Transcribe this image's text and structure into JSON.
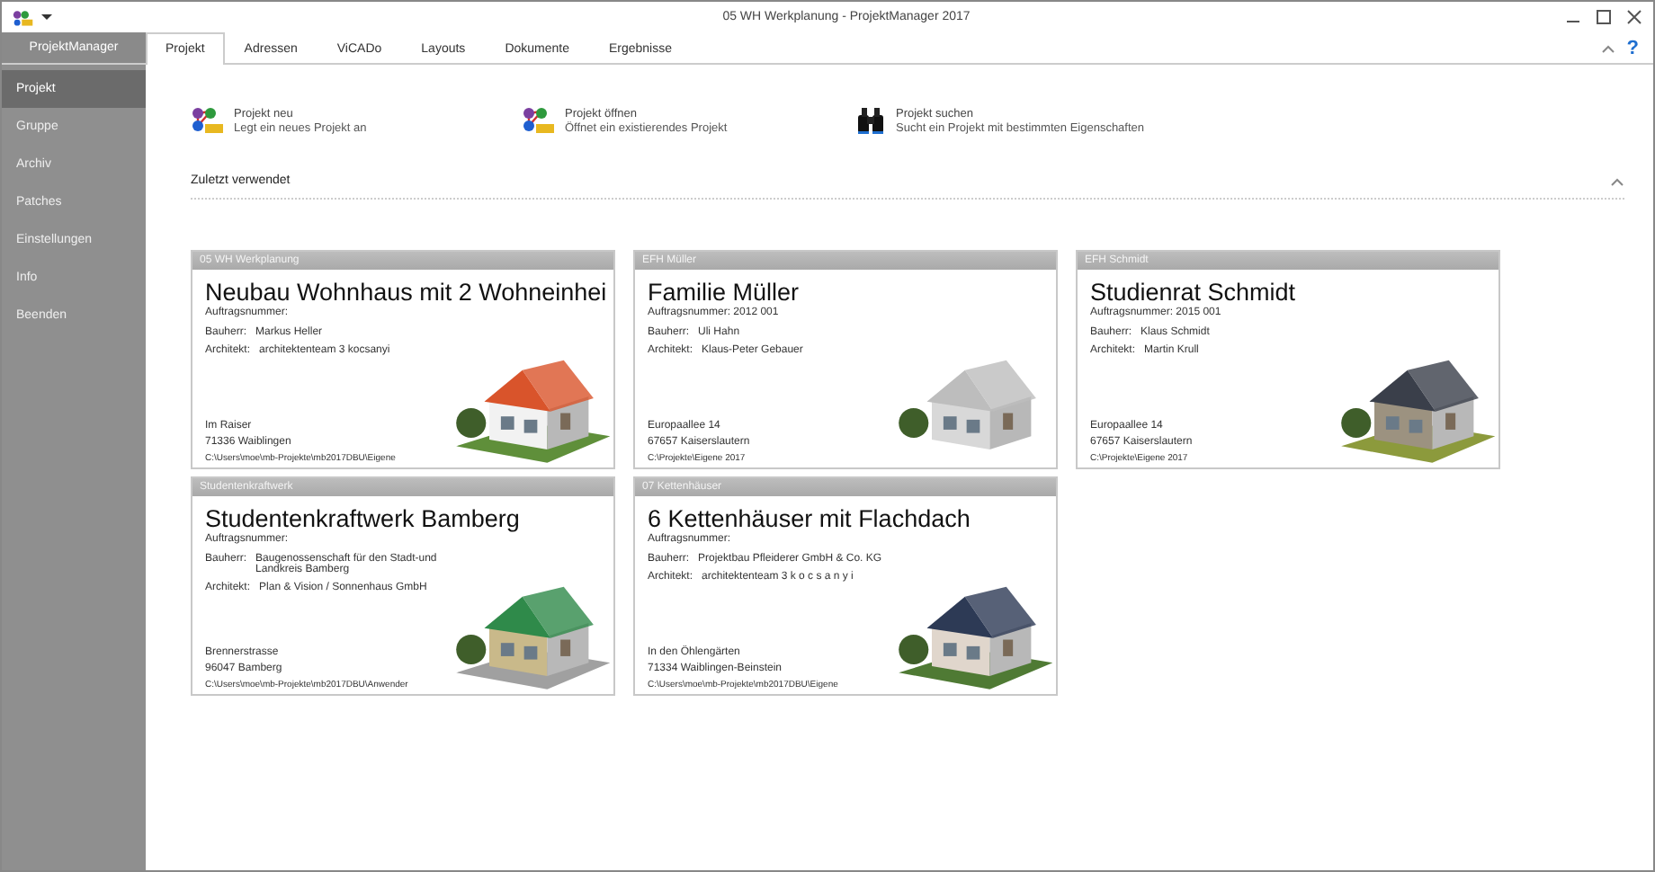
{
  "window": {
    "title": "05 WH Werkplanung - ProjektManager 2017",
    "help": "?"
  },
  "app_tab": "ProjektManager",
  "tabs": [
    {
      "label": "Projekt",
      "selected": true
    },
    {
      "label": "Adressen",
      "selected": false
    },
    {
      "label": "ViCADo",
      "selected": false
    },
    {
      "label": "Layouts",
      "selected": false
    },
    {
      "label": "Dokumente",
      "selected": false
    },
    {
      "label": "Ergebnisse",
      "selected": false
    }
  ],
  "sidebar": {
    "items": [
      {
        "label": "Projekt",
        "selected": true
      },
      {
        "label": "Gruppe",
        "selected": false
      },
      {
        "label": "Archiv",
        "selected": false
      },
      {
        "label": "Patches",
        "selected": false
      },
      {
        "label": "Einstellungen",
        "selected": false
      },
      {
        "label": "Info",
        "selected": false
      },
      {
        "label": "Beenden",
        "selected": false
      }
    ]
  },
  "actions": [
    {
      "kind": "new",
      "title": "Projekt neu",
      "description": "Legt ein neues Projekt an"
    },
    {
      "kind": "open",
      "title": "Projekt öffnen",
      "description": "Öffnet ein existierendes Projekt"
    },
    {
      "kind": "search",
      "title": "Projekt suchen",
      "description": "Sucht ein Projekt mit bestimmten Eigenschaften"
    }
  ],
  "recent": {
    "heading": "Zuletzt verwendet",
    "cards": [
      {
        "header": "05 WH Werkplanung",
        "title": "Neubau Wohnhaus mit 2 Wohneinhei",
        "order": "Auftragsnummer:",
        "client_label": "Bauherr:",
        "client": "Markus Heller",
        "architect_label": "Architekt:",
        "architect": "architektenteam 3 kocsanyi",
        "street": "Im Raiser",
        "city": "71336 Waiblingen",
        "path": "C:\\Users\\moe\\mb-Projekte\\mb2017DBU\\Eigene",
        "kind": "picture"
      },
      {
        "header": "EFH Müller",
        "title": "Familie Müller",
        "order": "Auftragsnummer: 2012 001",
        "client_label": "Bauherr:",
        "client": "Uli Hahn",
        "architect_label": "Architekt:",
        "architect": "Klaus-Peter Gebauer",
        "street": "Europaallee 14",
        "city": "67657 Kaiserslautern",
        "path": "C:\\Projekte\\Eigene 2017",
        "kind": "picture"
      },
      {
        "header": "EFH Schmidt",
        "title": "Studienrat Schmidt",
        "order": "Auftragsnummer: 2015 001",
        "client_label": "Bauherr:",
        "client": "Klaus Schmidt",
        "architect_label": "Architekt:",
        "architect": "Martin Krull",
        "street": "Europaallee 14",
        "city": "67657 Kaiserslautern",
        "path": "C:\\Projekte\\Eigene 2017",
        "kind": "picture"
      },
      {
        "header": "Studentenkraftwerk",
        "title": "Studentenkraftwerk Bamberg",
        "order": "Auftragsnummer:",
        "client_label": "Bauherr:",
        "client": "Baugenossenschaft für den Stadt-und Landkreis Bamberg",
        "architect_label": "Architekt:",
        "architect": "Plan & Vision / Sonnenhaus GmbH",
        "street": "Brennerstrasse",
        "city": "96047 Bamberg",
        "path": "C:\\Users\\moe\\mb-Projekte\\mb2017DBU\\Anwender",
        "kind": "picture"
      },
      {
        "header": "07 Kettenhäuser",
        "title": "6 Kettenhäuser mit Flachdach",
        "order": "Auftragsnummer:",
        "client_label": "Bauherr:",
        "client": "Projektbau Pfleiderer GmbH & Co. KG",
        "architect_label": "Architekt:",
        "architect": "architektenteam 3  k o c s a n y i",
        "street": "In den Öhlengärten",
        "city": "71334 Waiblingen-Beinstein",
        "path": "C:\\Users\\moe\\mb-Projekte\\mb2017DBU\\Eigene",
        "kind": "picture"
      }
    ]
  }
}
